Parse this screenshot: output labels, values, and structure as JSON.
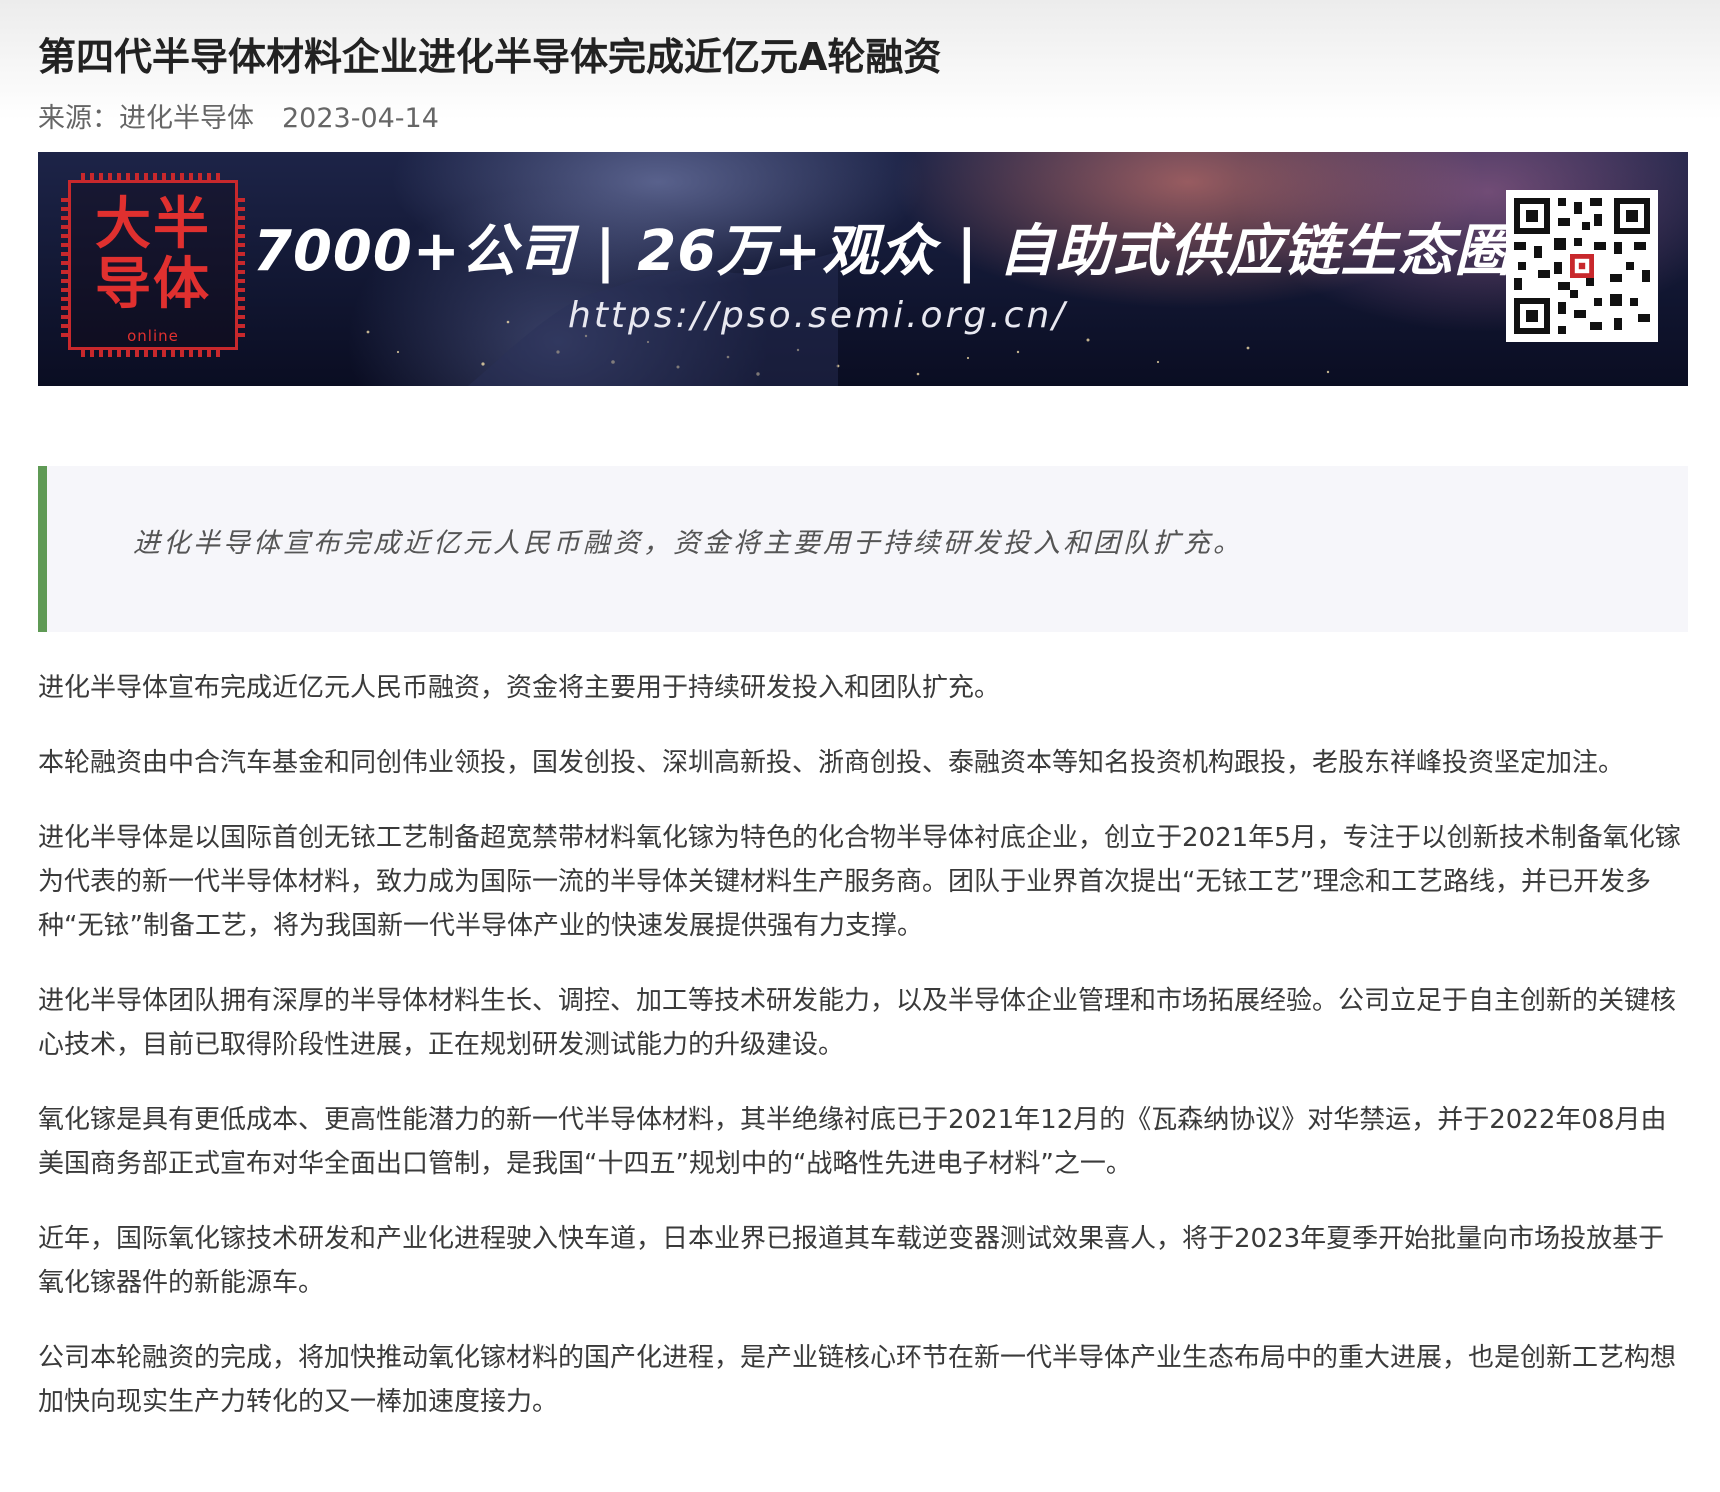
{
  "article": {
    "title": "第四代半导体材料企业进化半导体完成近亿元A轮融资",
    "source": "来源：进化半导体",
    "date": "2023-04-14"
  },
  "banner": {
    "logo_text": "大半导体",
    "logo_small": "online",
    "slogan": "7000+公司 | 26万+观众 | 自助式供应链生态圈",
    "url": "https://pso.semi.org.cn/"
  },
  "quote": "进化半导体宣布完成近亿元人民币融资，资金将主要用于持续研发投入和团队扩充。",
  "paragraphs": [
    "进化半导体宣布完成近亿元人民币融资，资金将主要用于持续研发投入和团队扩充。",
    "本轮融资由中合汽车基金和同创伟业领投，国发创投、深圳高新投、浙商创投、泰融资本等知名投资机构跟投，老股东祥峰投资坚定加注。",
    "进化半导体是以国际首创无铱工艺制备超宽禁带材料氧化镓为特色的化合物半导体衬底企业，创立于2021年5月，专注于以创新技术制备氧化镓为代表的新一代半导体材料，致力成为国际一流的半导体关键材料生产服务商。团队于业界首次提出“无铱工艺”理念和工艺路线，并已开发多种“无铱”制备工艺，将为我国新一代半导体产业的快速发展提供强有力支撑。",
    "进化半导体团队拥有深厚的半导体材料生长、调控、加工等技术研发能力，以及半导体企业管理和市场拓展经验。公司立足于自主创新的关键核心技术，目前已取得阶段性进展，正在规划研发测试能力的升级建设。",
    "氧化镓是具有更低成本、更高性能潜力的新一代半导体材料，其半绝缘衬底已于2021年12月的《瓦森纳协议》对华禁运，并于2022年08月由美国商务部正式宣布对华全面出口管制，是我国“十四五”规划中的“战略性先进电子材料”之一。",
    "近年，国际氧化镓技术研发和产业化进程驶入快车道，日本业界已报道其车载逆变器测试效果喜人，将于2023年夏季开始批量向市场投放基于氧化镓器件的新能源车。",
    "公司本轮融资的完成，将加快推动氧化镓材料的国产化进程，是产业链核心环节在新一代半导体产业生态布局中的重大进展，也是创新工艺构想加快向现实生产力转化的又一棒加速度接力。"
  ]
}
